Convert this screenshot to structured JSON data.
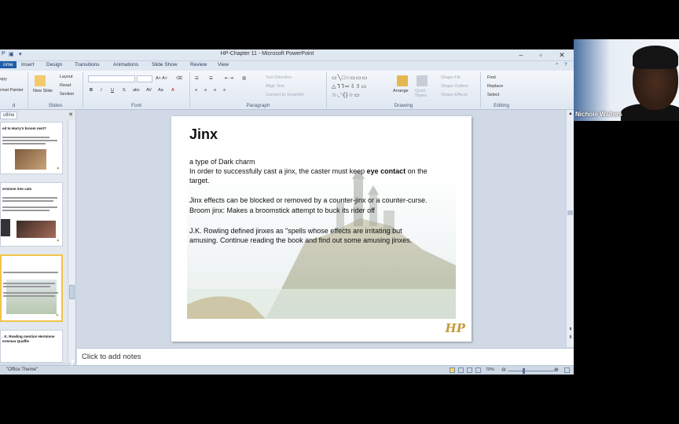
{
  "window": {
    "title": "HP-Chapter 11  -  Microsoft PowerPoint"
  },
  "ribbon": {
    "tabs": [
      "ome",
      "Insert",
      "Design",
      "Transitions",
      "Animations",
      "Slide Show",
      "Review",
      "View"
    ],
    "groups": {
      "clipboard": "d",
      "slides": "Slides",
      "font": "Font",
      "paragraph": "Paragraph",
      "drawing": "Drawing",
      "editing": "Editing"
    },
    "clipboard_items": [
      "opy",
      "rmat Painter"
    ],
    "slides_items": {
      "new_slide": "New Slide",
      "layout": "Layout",
      "reset": "Reset",
      "section": "Section"
    },
    "paragraph_items": {
      "text_direction": "Text Direction",
      "align_text": "Align Text",
      "smartart": "Convert to SmartArt"
    },
    "drawing_items": {
      "arrange": "Arrange",
      "quick_styles": "Quick Styles",
      "shape_fill": "Shape Fill",
      "shape_outline": "Shape Outline",
      "shape_effects": "Shape Effects"
    },
    "editing_items": {
      "find": "Find",
      "replace": "Replace",
      "select": "Select"
    }
  },
  "left_panel": {
    "tab": "utline",
    "thumbnails": [
      {
        "title": "ed to Harry's  broom next?"
      },
      {
        "title": "ermione into cats"
      },
      {
        "title": ""
      },
      {
        "title": ". K. Rowling  mention Hermione  ermesar  Quaflle"
      }
    ]
  },
  "slide": {
    "title": "Jinx",
    "line1": "a type of Dark charm",
    "line2_a": "In order to successfully cast a jinx, the caster must keep ",
    "line2_b": "eye contact",
    "line2_c": " on the",
    "line3": "target.",
    "line4": "Jinx effects can be blocked or removed by a counter-jinx or a counter-curse.",
    "line5": "Broom jinx: Makes a broomstick attempt to buck its rider off",
    "line6": "J.K. Rowling defined jinxes as \"spells whose effects are irritating but",
    "line7": "amusing. Continue reading the book and find out some amusing jinxes.",
    "logo": "HP"
  },
  "notes": {
    "placeholder": "Click to add notes"
  },
  "status": {
    "theme": "\"Office Theme\"",
    "zoom": "70%"
  },
  "webcam": {
    "name": "Nichole Walters"
  }
}
